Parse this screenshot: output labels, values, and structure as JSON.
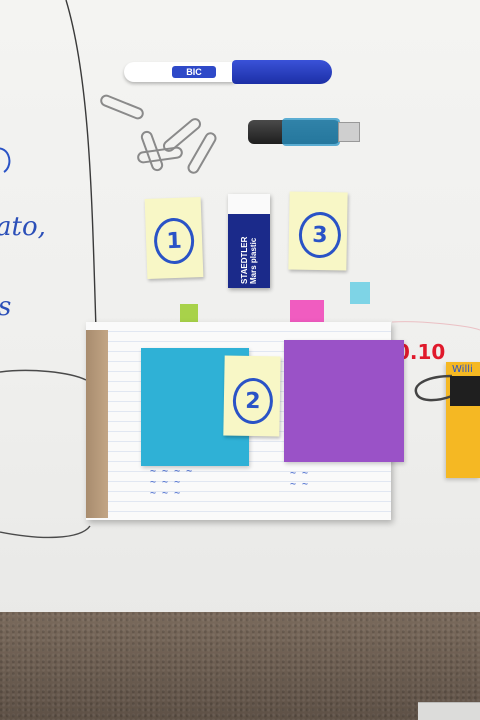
{
  "photo": {
    "side_text": [
      "ato,",
      "s"
    ],
    "red_text": "0.10",
    "pen_brand": "BIC",
    "eraser_label": "STAEDTLER Mars plastic",
    "binder_label": "Willi",
    "sticky_notes": [
      {
        "label": "1"
      },
      {
        "label": "3"
      },
      {
        "label": "2"
      }
    ],
    "colors": {
      "sticky_yellow": "#f8f7c6",
      "note_blue": "#2fb1d6",
      "note_purple": "#9a52c7",
      "ink_blue": "#2a53c6",
      "red_marker": "#e0192b",
      "orange_note": "#f5b823"
    },
    "icons": [
      "paperclip-icon",
      "binder-clip-icon",
      "marker-pen",
      "usb-drive",
      "eraser"
    ]
  }
}
